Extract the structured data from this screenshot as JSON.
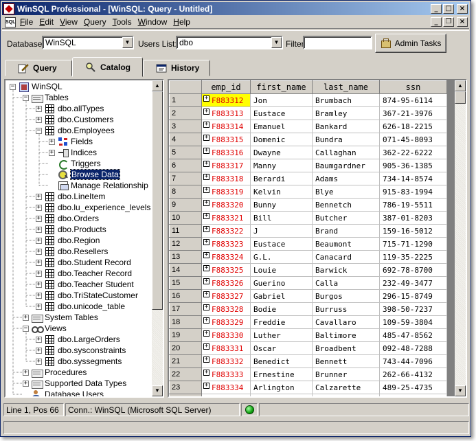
{
  "window": {
    "title": "WinSQL Professional - [WinSQL: Query - Untitled]"
  },
  "menu": {
    "doc_icon": "SQL",
    "items": [
      "File",
      "Edit",
      "View",
      "Query",
      "Tools",
      "Window",
      "Help"
    ]
  },
  "toolbar": {
    "database_label": "Database",
    "database_value": "WinSQL",
    "users_label": "Users List:",
    "users_value": "dbo",
    "filter_label": "Filter",
    "filter_value": "",
    "admin_label": "Admin Tasks"
  },
  "tabs": [
    {
      "label": "Query",
      "icon": "pencil-icon"
    },
    {
      "label": "Catalog",
      "icon": "catalog-icon",
      "active": true
    },
    {
      "label": "History",
      "icon": "history-icon"
    }
  ],
  "tree": [
    {
      "label": "WinSQL",
      "icon": "db",
      "level": 0,
      "exp": "-"
    },
    {
      "label": "Tables",
      "icon": "folder",
      "level": 1,
      "exp": "-"
    },
    {
      "label": "dbo.allTypes",
      "icon": "table",
      "level": 2,
      "exp": "+"
    },
    {
      "label": "dbo.Customers",
      "icon": "table",
      "level": 2,
      "exp": "+"
    },
    {
      "label": "dbo.Employees",
      "icon": "table",
      "level": 2,
      "exp": "-"
    },
    {
      "label": "Fields",
      "icon": "fields",
      "level": 3,
      "exp": "+"
    },
    {
      "label": "Indices",
      "icon": "indices",
      "level": 3,
      "exp": "+"
    },
    {
      "label": "Triggers",
      "icon": "trigger",
      "level": 3,
      "exp": ""
    },
    {
      "label": "Browse Data",
      "icon": "browse",
      "level": 3,
      "exp": "",
      "selected": true
    },
    {
      "label": "Manage Relationship",
      "icon": "manage",
      "level": 3,
      "exp": ""
    },
    {
      "label": "dbo.LineItem",
      "icon": "table",
      "level": 2,
      "exp": "+"
    },
    {
      "label": "dbo.lu_experience_levels",
      "icon": "table",
      "level": 2,
      "exp": "+"
    },
    {
      "label": "dbo.Orders",
      "icon": "table",
      "level": 2,
      "exp": "+"
    },
    {
      "label": "dbo.Products",
      "icon": "table",
      "level": 2,
      "exp": "+"
    },
    {
      "label": "dbo.Region",
      "icon": "table",
      "level": 2,
      "exp": "+"
    },
    {
      "label": "dbo.Resellers",
      "icon": "table",
      "level": 2,
      "exp": "+"
    },
    {
      "label": "dbo.Student Record",
      "icon": "table",
      "level": 2,
      "exp": "+"
    },
    {
      "label": "dbo.Teacher Record",
      "icon": "table",
      "level": 2,
      "exp": "+"
    },
    {
      "label": "dbo.Teacher Student",
      "icon": "table",
      "level": 2,
      "exp": "+"
    },
    {
      "label": "dbo.TriStateCustomer",
      "icon": "table",
      "level": 2,
      "exp": "+"
    },
    {
      "label": "dbo.unicode_table",
      "icon": "table",
      "level": 2,
      "exp": "+"
    },
    {
      "label": "System Tables",
      "icon": "folder",
      "level": 1,
      "exp": "+"
    },
    {
      "label": "Views",
      "icon": "views",
      "level": 1,
      "exp": "-"
    },
    {
      "label": "dbo.LargeOrders",
      "icon": "table",
      "level": 2,
      "exp": "+"
    },
    {
      "label": "dbo.sysconstraints",
      "icon": "table",
      "level": 2,
      "exp": "+"
    },
    {
      "label": "dbo.syssegments",
      "icon": "table",
      "level": 2,
      "exp": "+"
    },
    {
      "label": "Procedures",
      "icon": "folder",
      "level": 1,
      "exp": "+"
    },
    {
      "label": "Supported Data Types",
      "icon": "folder",
      "level": 1,
      "exp": "+"
    },
    {
      "label": "Database Users",
      "icon": "users",
      "level": 1,
      "exp": ""
    }
  ],
  "grid": {
    "columns": [
      "emp_id",
      "first_name",
      "last_name",
      "ssn"
    ],
    "rows": [
      [
        "1",
        "F883312",
        "Jon",
        "Brumbach",
        "874-95-6114"
      ],
      [
        "2",
        "F883313",
        "Eustace",
        "Bramley",
        "367-21-3976"
      ],
      [
        "3",
        "F883314",
        "Emanuel",
        "Bankard",
        "626-18-2215"
      ],
      [
        "4",
        "F883315",
        "Domenic",
        "Bundra",
        "071-45-8093"
      ],
      [
        "5",
        "F883316",
        "Dwayne",
        "Callaghan",
        "362-22-6222"
      ],
      [
        "6",
        "F883317",
        "Manny",
        "Baumgardner",
        "905-36-1385"
      ],
      [
        "7",
        "F883318",
        "Berardi",
        "Adams",
        "734-14-8574"
      ],
      [
        "8",
        "F883319",
        "Kelvin",
        "Blye",
        "915-83-1994"
      ],
      [
        "9",
        "F883320",
        "Bunny",
        "Bennetch",
        "786-19-5511"
      ],
      [
        "10",
        "F883321",
        "Bill",
        "Butcher",
        "387-01-8203"
      ],
      [
        "11",
        "F883322",
        "J",
        "Brand",
        "159-16-5012"
      ],
      [
        "12",
        "F883323",
        "Eustace",
        "Beaumont",
        "715-71-1290"
      ],
      [
        "13",
        "F883324",
        "G.L.",
        "Canacard",
        "119-35-2225"
      ],
      [
        "14",
        "F883325",
        "Louie",
        "Barwick",
        "692-78-8700"
      ],
      [
        "15",
        "F883326",
        "Guerino",
        "Calla",
        "232-49-3477"
      ],
      [
        "16",
        "F883327",
        "Gabriel",
        "Burgos",
        "296-15-8749"
      ],
      [
        "17",
        "F883328",
        "Bodie",
        "Burruss",
        "398-50-7237"
      ],
      [
        "18",
        "F883329",
        "Freddie",
        "Cavallaro",
        "109-59-3804"
      ],
      [
        "19",
        "F883330",
        "Luther",
        "Baltimore",
        "485-47-8562"
      ],
      [
        "20",
        "F883331",
        "Oscar",
        "Broadbent",
        "092-48-7288"
      ],
      [
        "21",
        "F883332",
        "Benedict",
        "Bennett",
        "743-44-7096"
      ],
      [
        "22",
        "F883333",
        "Ernestine",
        "Brunner",
        "262-66-4132"
      ],
      [
        "23",
        "F883334",
        "Arlington",
        "Calzarette",
        "489-25-4735"
      ]
    ]
  },
  "status": {
    "position": "Line 1, Pos 66",
    "connection": "Conn.: WinSQL (Microsoft SQL Server)"
  },
  "colors": {
    "titlebar_start": "#0a246a",
    "titlebar_end": "#a6caf0",
    "emp_id_text": "#e00000",
    "current_cell": "#ffff00",
    "selection": "#0a246a",
    "status_led": "#10a010"
  }
}
